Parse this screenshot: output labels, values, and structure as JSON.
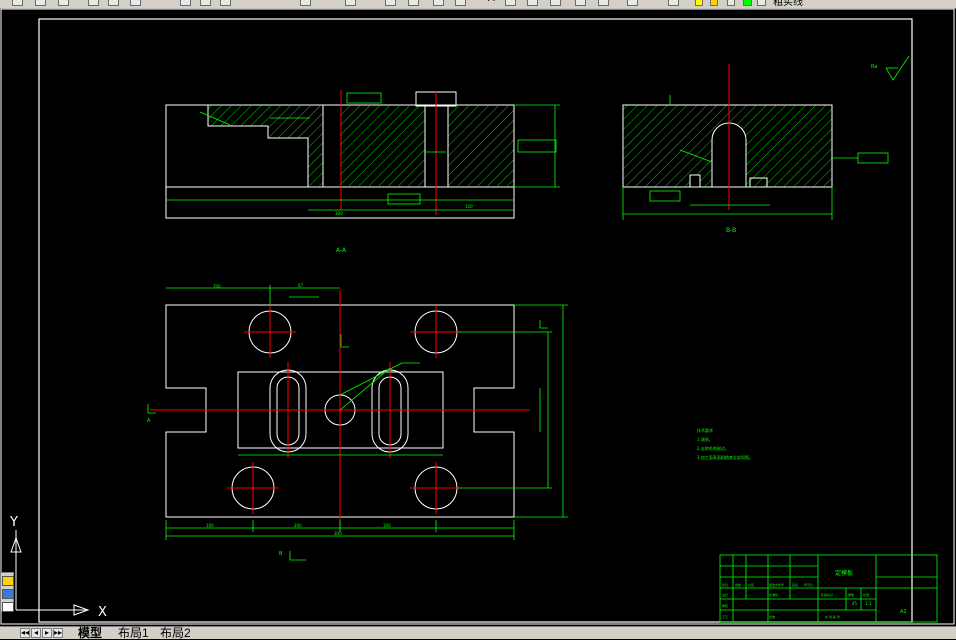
{
  "toolbar": {
    "layer_name": "粗实线",
    "text_style_label": "A"
  },
  "drawing": {
    "section_a_label": "A-A",
    "section_b_label": "B-B",
    "roughness_note": "Ra",
    "plan_label_a": "A",
    "plan_label_b": "B",
    "tech_requirements": {
      "title": "技术要求",
      "lines": [
        "1.调质。",
        "2.去除毛刺锐边。",
        "3.加工面表面粗糙度全部如图。"
      ]
    },
    "dims_top": [
      "300",
      "100",
      "200"
    ],
    "dims_plan": [
      "700",
      "67",
      "100",
      "200",
      "100",
      "300",
      "100",
      "200"
    ],
    "title_block": {
      "part_name": "定模板",
      "scale": "1:1",
      "material": "45",
      "sheet": "A2",
      "left_cells": [
        "标记",
        "处数",
        "分区",
        "更改文件号",
        "签名",
        "年月日",
        "设计",
        "标准化",
        "审核",
        "工艺",
        "批准"
      ],
      "right_cells": [
        "阶段标记",
        "重量",
        "比例",
        "共  张  第  张"
      ]
    }
  },
  "ucs": {
    "y_label": "Y",
    "x_label": "X"
  },
  "tabs": {
    "nav": [
      "◂◂",
      "◂",
      "▸",
      "▸▸"
    ],
    "model": "模型",
    "layout1": "布局1",
    "layout2": "布局2"
  },
  "colors": {
    "background": "#000000",
    "outline": "#ffffff",
    "dimension": "#00ff00",
    "centerline": "#ff0000"
  }
}
